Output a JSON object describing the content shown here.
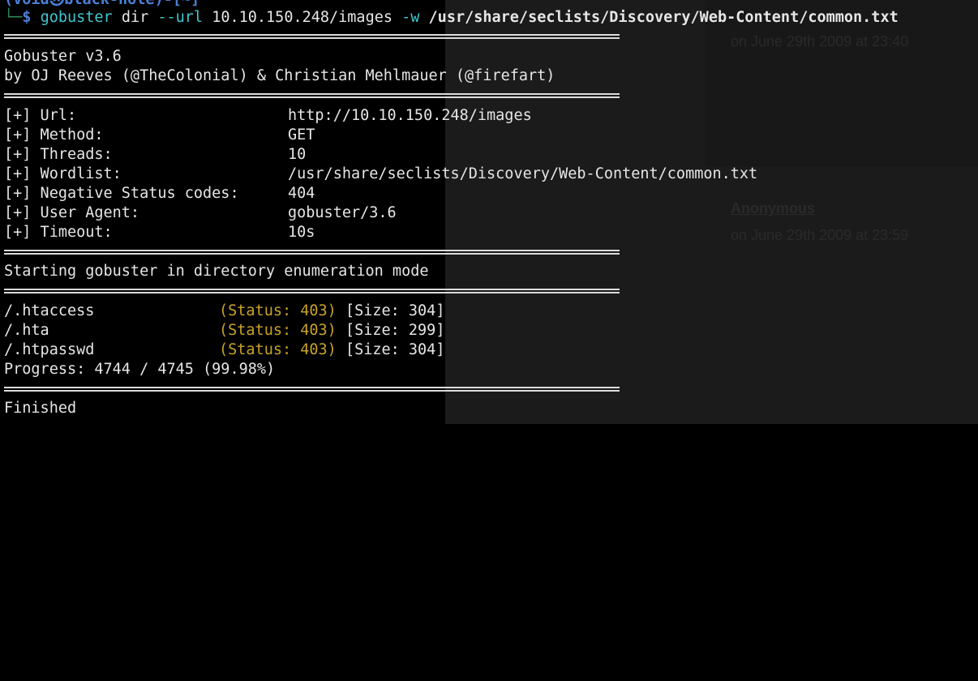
{
  "background": {
    "posted_1": "on June 29th 2009 at 23:40",
    "author": "Anonymous",
    "posted_2": "on June 29th 2009 at 23:59"
  },
  "terminal": {
    "prompt_top": "(void㉿black-hole)-[~]",
    "cmd": {
      "corner": "└─",
      "dollar": "$",
      "program": "gobuster",
      "sub": "dir",
      "url_flag": "--url",
      "url": "10.10.150.248/images",
      "w_flag": "-w",
      "wordlist": "/usr/share/seclists/Discovery/Web-Content/common.txt"
    },
    "banner_line1": "Gobuster v3.6",
    "banner_line2": "by OJ Reeves (@TheColonial) & Christian Mehlmauer (@firefart)",
    "config": [
      {
        "key": "[+] Url:",
        "value": "http://10.10.150.248/images"
      },
      {
        "key": "[+] Method:",
        "value": "GET"
      },
      {
        "key": "[+] Threads:",
        "value": "10"
      },
      {
        "key": "[+] Wordlist:",
        "value": "/usr/share/seclists/Discovery/Web-Content/common.txt"
      },
      {
        "key": "[+] Negative Status codes:",
        "value": "404"
      },
      {
        "key": "[+] User Agent:",
        "value": "gobuster/3.6"
      },
      {
        "key": "[+] Timeout:",
        "value": "10s"
      }
    ],
    "starting": "Starting gobuster in directory enumeration mode",
    "results": [
      {
        "path": "/.htaccess",
        "status": "(Status: 403)",
        "size": "[Size: 304]"
      },
      {
        "path": "/.hta",
        "status": "(Status: 403)",
        "size": "[Size: 299]"
      },
      {
        "path": "/.htpasswd",
        "status": "(Status: 403)",
        "size": "[Size: 304]"
      }
    ],
    "progress": "Progress: 4744 / 4745 (99.98%)",
    "finished": "Finished"
  }
}
